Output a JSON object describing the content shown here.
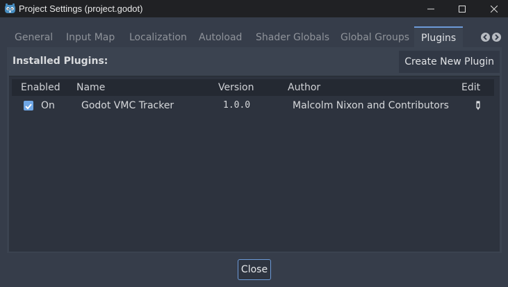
{
  "window": {
    "title": "Project Settings (project.godot)",
    "controls": [
      "minimize-icon",
      "maximize-icon",
      "close-icon"
    ]
  },
  "tabs": [
    {
      "label": "General",
      "active": false
    },
    {
      "label": "Input Map",
      "active": false
    },
    {
      "label": "Localization",
      "active": false
    },
    {
      "label": "Autoload",
      "active": false
    },
    {
      "label": "Shader Globals",
      "active": false
    },
    {
      "label": "Global Groups",
      "active": false
    },
    {
      "label": "Plugins",
      "active": true
    }
  ],
  "plugins_panel": {
    "installed_label": "Installed Plugins:",
    "create_button": "Create New Plugin",
    "columns": [
      "Enabled",
      "Name",
      "Version",
      "Author",
      "Edit"
    ],
    "rows": [
      {
        "enabled": true,
        "enabled_label": "On",
        "name": "Godot VMC Tracker",
        "version": "1.0.0",
        "author": "Malcolm Nixon and Contributors",
        "edit_icon": "edit-icon"
      }
    ]
  },
  "footer": {
    "close_button": "Close"
  },
  "colors": {
    "accent": "#6c9ad8",
    "checkbox": "#6fa7e6",
    "background": "#363d4a"
  }
}
